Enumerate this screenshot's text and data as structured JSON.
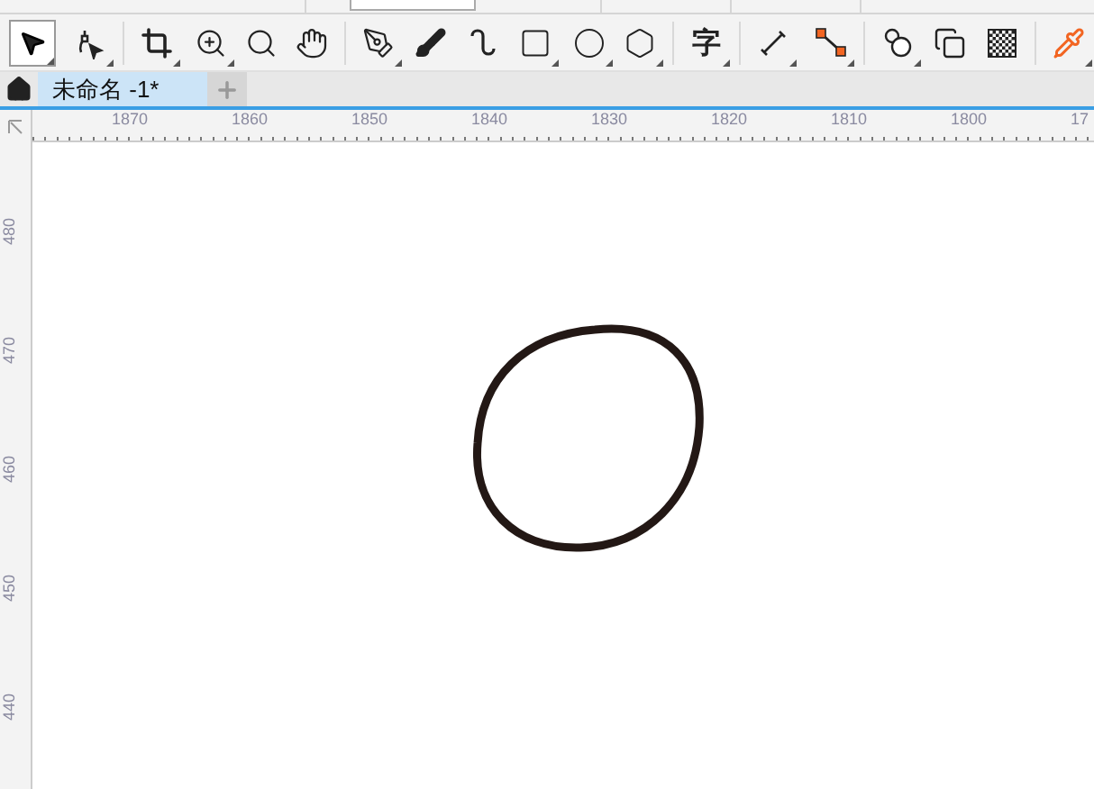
{
  "toolbar": {
    "text_tool_glyph": "字"
  },
  "document_tabs": [
    {
      "label": "未命名 -1*",
      "selected": true
    }
  ],
  "horizontal_ruler": {
    "labels": [
      "1870",
      "1860",
      "1850",
      "1840",
      "1830",
      "1820",
      "1810",
      "1800",
      "17"
    ]
  },
  "vertical_ruler": {
    "labels": [
      "480",
      "470",
      "460",
      "450",
      "440"
    ]
  }
}
